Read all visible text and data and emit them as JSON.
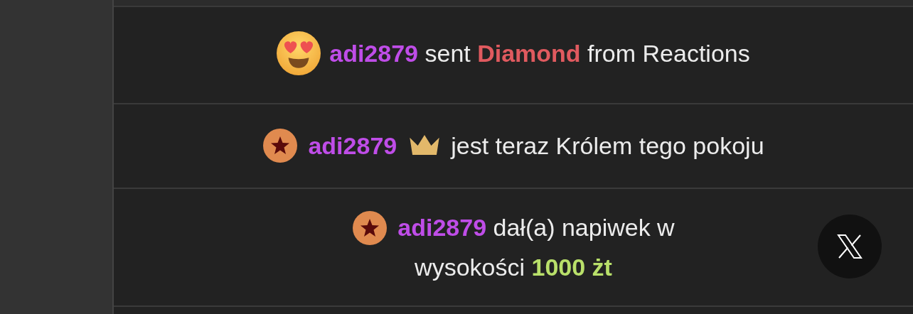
{
  "messages": [
    {
      "kind": "reaction",
      "user": "adi2879",
      "parts": [
        {
          "kind": "plain",
          "text": "sent"
        },
        {
          "kind": "gift",
          "text": "Diamond"
        },
        {
          "kind": "plain",
          "text": "from Reactions"
        }
      ]
    },
    {
      "kind": "king",
      "user": "adi2879",
      "parts": [
        {
          "kind": "plain",
          "text": "jest teraz Królem tego pokoju"
        }
      ]
    },
    {
      "kind": "tip",
      "user": "adi2879",
      "parts": [
        {
          "kind": "plain",
          "text": "dał(a) napiwek w"
        },
        {
          "kind": "break"
        },
        {
          "kind": "plain",
          "text": "wysokości"
        },
        {
          "kind": "amount",
          "text": "1000 żt"
        }
      ]
    }
  ]
}
